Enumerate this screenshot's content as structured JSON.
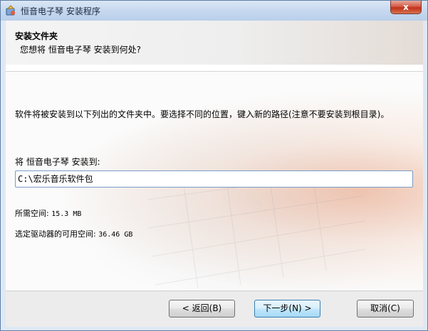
{
  "window": {
    "title": "恒音电子琴 安装程序",
    "close_label": "x"
  },
  "header": {
    "title": "安装文件夹",
    "subtitle": "您想将 恒音电子琴 安装到何处?"
  },
  "content": {
    "description": "软件将被安装到以下列出的文件夹中。要选择不同的位置，键入新的路径(注意不要安装到根目录)。",
    "install_label": "将 恒音电子琴 安装到:",
    "install_path": "C:\\宏乐音乐软件包",
    "required_space_label": "所需空间:",
    "required_space_value": "15.3 MB",
    "available_space_label": "选定驱动器的可用空间:",
    "available_space_value": "36.46 GB"
  },
  "buttons": {
    "back": "< 返回(B)",
    "next": "下一步(N) >",
    "cancel": "取消(C)"
  },
  "colors": {
    "titlebar": "#c6d8ef",
    "close": "#c0301a",
    "primary_button": "#bee6fd"
  }
}
